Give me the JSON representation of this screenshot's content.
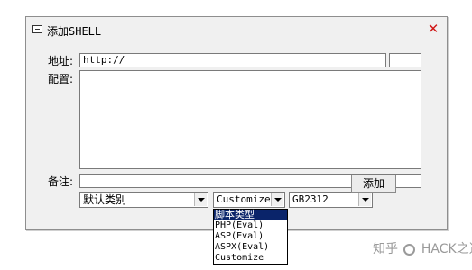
{
  "dialog": {
    "title": "添加SHELL",
    "close_label": "✕"
  },
  "form": {
    "address_label": "地址:",
    "address_value": "http://",
    "password_value": "",
    "config_label": "配置:",
    "config_value": "",
    "note_label": "备注:",
    "note_value": "",
    "category_selected": "默认类别",
    "script_type_selected": "Customize",
    "encoding_selected": "GB2312",
    "add_button_label": "添加"
  },
  "script_type_dropdown": {
    "options": [
      "脚本类型",
      "PHP(Eval)",
      "ASP(Eval)",
      "ASPX(Eval)",
      "Customize"
    ],
    "highlighted_index": 0
  },
  "watermark": {
    "prefix": "知乎",
    "suffix": "HACK之道"
  },
  "icons": {
    "window": "window-icon",
    "close": "close-icon",
    "dropdown_arrow": "chevron-down-icon"
  },
  "colors": {
    "close": "#d01818",
    "selection": "#0a246a"
  }
}
